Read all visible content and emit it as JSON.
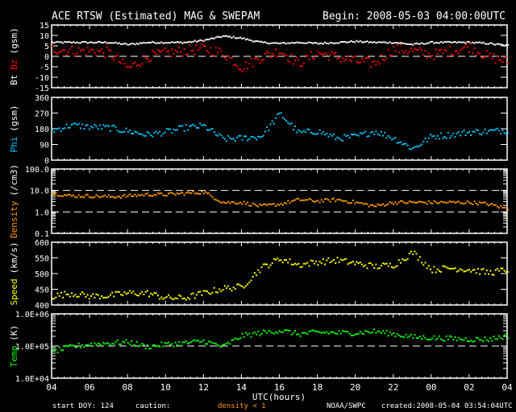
{
  "header": {
    "title": "ACE RTSW (Estimated) MAG & SWEPAM",
    "begin": "Begin: 2008-05-03 04:00:00UTC"
  },
  "footer": {
    "start_doy": "start DOY: 124",
    "caution": "caution:",
    "caution_note": "density < 1",
    "agency": "NOAA/SWPC",
    "created": "created:2008-05-04 03:54:04UTC"
  },
  "colors": {
    "bt": "#ffffff",
    "bz": "#ff0000",
    "phi": "#00c8ff",
    "density": "#ff9900",
    "speed": "#ffff00",
    "temp": "#00ff00"
  },
  "chart_data": {
    "type": "scatter",
    "title": "ACE RTSW (Estimated) MAG & SWEPAM",
    "xlabel": "UTC(hours)",
    "x_ticks": [
      "04",
      "06",
      "08",
      "10",
      "12",
      "14",
      "16",
      "18",
      "20",
      "22",
      "00",
      "02",
      "04"
    ],
    "x_range_hours": [
      0,
      24
    ],
    "x_hours": [
      0,
      1,
      2,
      3,
      4,
      5,
      6,
      7,
      8,
      9,
      10,
      11,
      12,
      13,
      14,
      15,
      16,
      17,
      18,
      19,
      20,
      21,
      22,
      23,
      24
    ],
    "panels": [
      {
        "id": "mag",
        "ylabel_parts": [
          "Bt",
          "Bz",
          "(gsm)"
        ],
        "scale": "linear",
        "ylim": [
          -15,
          15
        ],
        "yticks": [
          {
            "v": 15,
            "label": "15"
          },
          {
            "v": 10,
            "label": "10"
          },
          {
            "v": 5,
            "label": "5"
          },
          {
            "v": 0,
            "label": "0"
          },
          {
            "v": -5,
            "label": "-5"
          },
          {
            "v": -10,
            "label": "-10"
          },
          {
            "v": -15,
            "label": "-15"
          }
        ],
        "dashed": [
          0
        ],
        "series": [
          {
            "name": "Bt",
            "color": "#ffffff",
            "values": [
              7,
              7,
              7,
              7,
              6,
              7,
              7,
              7,
              8,
              10,
              9,
              7,
              6.5,
              7,
              6.5,
              7,
              7.5,
              7,
              7,
              6,
              7,
              7,
              7,
              6.5,
              5.5
            ],
            "spread": 0.4
          },
          {
            "name": "Bz",
            "color": "#ff0000",
            "values": [
              4,
              3,
              3,
              2,
              -5.5,
              0,
              2,
              3,
              4,
              2,
              -5,
              0,
              3,
              -3,
              2,
              0,
              -2,
              -3,
              4,
              3,
              1,
              3,
              5,
              0,
              -2
            ],
            "spread": 2.5
          }
        ]
      },
      {
        "id": "phi",
        "ylabel_parts": [
          "Phi",
          "(gsm)"
        ],
        "scale": "linear",
        "ylim": [
          0,
          360
        ],
        "yticks": [
          {
            "v": 360,
            "label": "360"
          },
          {
            "v": 270,
            "label": "270"
          },
          {
            "v": 180,
            "label": "180"
          },
          {
            "v": 90,
            "label": "90"
          },
          {
            "v": 0,
            "label": "0"
          }
        ],
        "dashed": [],
        "series": [
          {
            "name": "Phi",
            "color": "#00c8ff",
            "values": [
              175,
              205,
              195,
              190,
              170,
              150,
              165,
              190,
              200,
              125,
              130,
              140,
              270,
              160,
              170,
              130,
              140,
              170,
              130,
              70,
              140,
              150,
              165,
              170,
              175
            ],
            "spread": 18
          }
        ]
      },
      {
        "id": "density",
        "ylabel_parts": [
          "Density",
          "(/cm3)"
        ],
        "scale": "log",
        "ylim": [
          0.1,
          100
        ],
        "yticks": [
          {
            "v": 100,
            "label": "100.0"
          },
          {
            "v": 10,
            "label": "10.0"
          },
          {
            "v": 1,
            "label": "1.0"
          },
          {
            "v": 0.1,
            "label": "0.1"
          }
        ],
        "dashed": [
          10,
          1
        ],
        "series": [
          {
            "name": "Density",
            "color": "#ff9900",
            "values": [
              8,
              6,
              6,
              5.5,
              6,
              7,
              7,
              8,
              9,
              3,
              3,
              2,
              2.5,
              4,
              3.5,
              4,
              3,
              2,
              3,
              3,
              3,
              3,
              3,
              2.5,
              1.5
            ],
            "spread": 0.08
          }
        ]
      },
      {
        "id": "speed",
        "ylabel_parts": [
          "Speed",
          "(km/s)"
        ],
        "scale": "linear",
        "ylim": [
          400,
          600
        ],
        "yticks": [
          {
            "v": 600,
            "label": "600"
          },
          {
            "v": 550,
            "label": "550"
          },
          {
            "v": 500,
            "label": "500"
          },
          {
            "v": 450,
            "label": "450"
          },
          {
            "v": 400,
            "label": "400"
          }
        ],
        "dashed": [],
        "series": [
          {
            "name": "Speed",
            "color": "#ffff00",
            "values": [
              430,
              440,
              430,
              432,
              440,
              440,
              425,
              425,
              440,
              455,
              460,
              520,
              550,
              530,
              540,
              545,
              535,
              525,
              530,
              570,
              515,
              520,
              515,
              505,
              515
            ],
            "spread": 10
          }
        ]
      },
      {
        "id": "temp",
        "ylabel_parts": [
          "Temp",
          "(K)"
        ],
        "scale": "log",
        "ylim": [
          10000,
          1000000
        ],
        "yticks": [
          {
            "v": 1000000,
            "label": "1.0E+06"
          },
          {
            "v": 100000,
            "label": "1.0E+05"
          },
          {
            "v": 10000,
            "label": "1.0E+04"
          }
        ],
        "dashed": [
          100000
        ],
        "series": [
          {
            "name": "Temp",
            "color": "#00ff00",
            "values": [
              70000,
              100000,
              120000,
              130000,
              140000,
              100000,
              120000,
              130000,
              150000,
              100000,
              220000,
              270000,
              320000,
              250000,
              280000,
              270000,
              270000,
              300000,
              250000,
              200000,
              190000,
              180000,
              170000,
              170000,
              220000
            ],
            "spread": 0.08
          }
        ]
      }
    ]
  }
}
